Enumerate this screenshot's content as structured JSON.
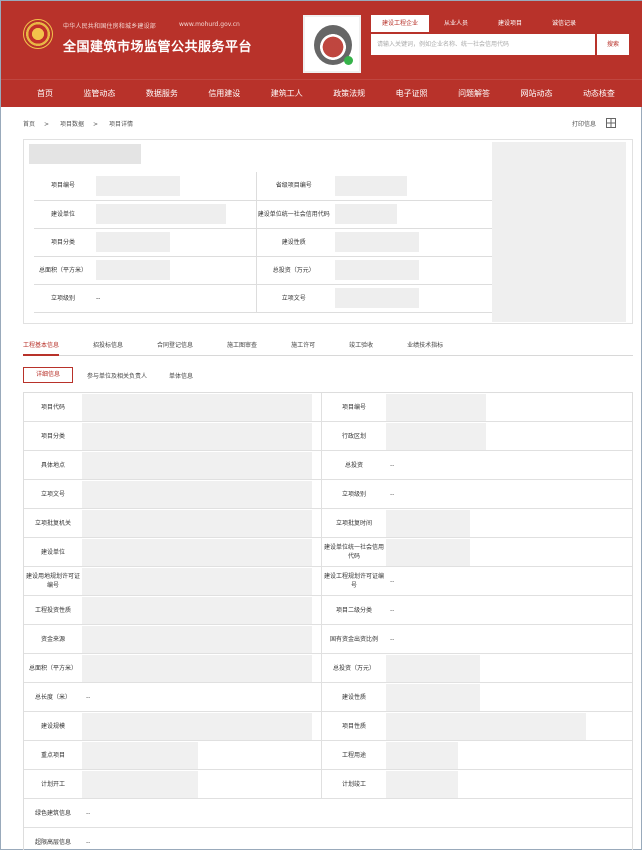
{
  "header": {
    "ministry": "中华人民共和国住房和城乡建设部",
    "site_url": "www.mohurd.gov.cn",
    "site_title": "全国建筑市场监管公共服务平台",
    "search_tabs": [
      "建设工程企业",
      "从业人员",
      "建设项目",
      "诚信记录"
    ],
    "search_placeholder": "请输入关键词，例如企业名称、统一社会信用代码",
    "search_button": "搜索"
  },
  "nav": [
    "首页",
    "监管动态",
    "数据服务",
    "信用建设",
    "建筑工人",
    "政策法规",
    "电子证照",
    "问题解答",
    "网站动态",
    "动态核查"
  ],
  "breadcrumb": [
    "首页",
    "项目数据",
    "项目详情"
  ],
  "print_link": "打印信息",
  "project_summary": {
    "rows": [
      [
        "项目编号",
        "",
        "省级项目编号",
        ""
      ],
      [
        "建设单位",
        "",
        "建设单位统一社会信用代码",
        ""
      ],
      [
        "项目分类",
        "",
        "建设性质",
        ""
      ],
      [
        "总面积（平方米）",
        "",
        "总投资（万元）",
        ""
      ],
      [
        "立项级别",
        "--",
        "立项文号",
        ""
      ]
    ]
  },
  "tabs": [
    "工程基本信息",
    "招投标信息",
    "合同登记信息",
    "施工图审查",
    "施工许可",
    "竣工验收",
    "业绩技术指标"
  ],
  "subtabs": [
    "详细信息",
    "参与单位及相关负责人",
    "单体信息"
  ],
  "details": [
    [
      "项目代码",
      "",
      "项目编号",
      ""
    ],
    [
      "项目分类",
      "",
      "行政区划",
      ""
    ],
    [
      "具体地点",
      "",
      "总投资",
      "--"
    ],
    [
      "立项文号",
      "",
      "立项级别",
      "--"
    ],
    [
      "立项批复机关",
      "",
      "立项批复时间",
      ""
    ],
    [
      "建设单位",
      "",
      "建设单位统一社会信用代码",
      ""
    ],
    [
      "建设用地规划许可证编号",
      "",
      "建设工程规划许可证编号",
      "--"
    ],
    [
      "工程投资性质",
      "",
      "项目二级分类",
      "--"
    ],
    [
      "资金来源",
      "",
      "国有资金出资比例",
      "--"
    ],
    [
      "总面积（平方米）",
      "",
      "总投资（万元）",
      ""
    ],
    [
      "总长度（米）",
      "--",
      "建设性质",
      ""
    ],
    [
      "建设规模",
      "",
      "项目性质",
      ""
    ],
    [
      "重点项目",
      "",
      "工程用途",
      ""
    ],
    [
      "计划开工",
      "",
      "计划竣工",
      ""
    ],
    [
      "绿色建筑信息",
      "--",
      "",
      ""
    ],
    [
      "超限高层信息",
      "--",
      "",
      ""
    ]
  ]
}
